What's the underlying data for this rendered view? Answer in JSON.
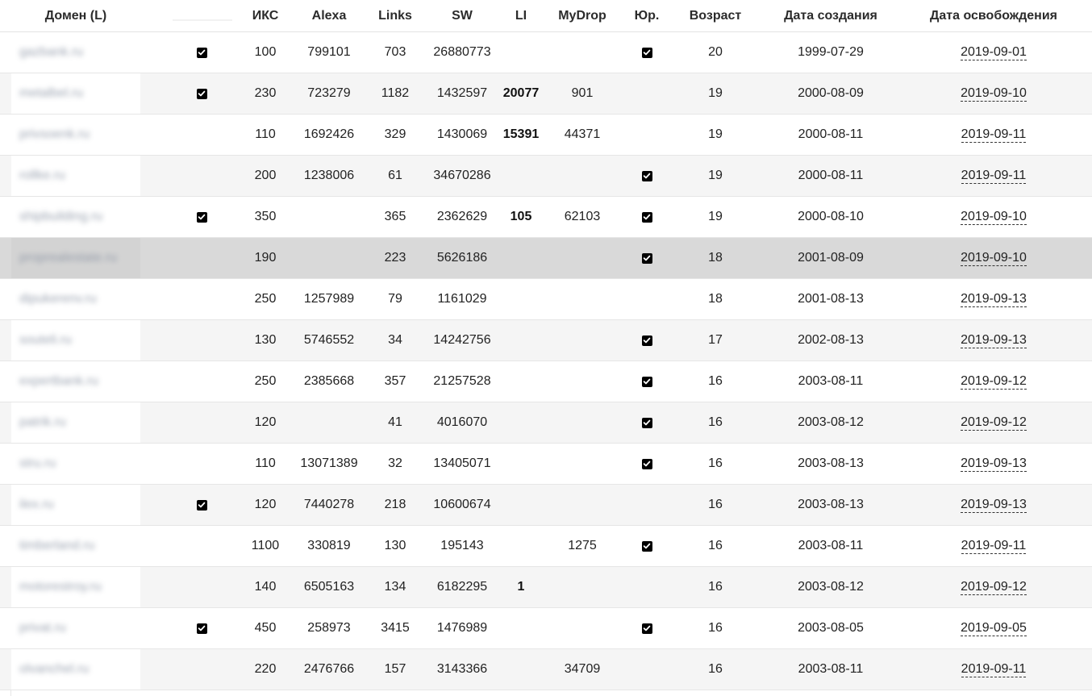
{
  "table": {
    "headers": {
      "domain": "Домен (L)",
      "blank": "",
      "iks": "ИКС",
      "alexa": "Alexa",
      "links": "Links",
      "sw": "SW",
      "li": "LI",
      "mydrop": "MyDrop",
      "yur": "Юр.",
      "age": "Возраст",
      "created": "Дата создания",
      "freed": "Дата освобождения"
    },
    "selected_row_index": 5,
    "rows": [
      {
        "domain": "gazbank.ru",
        "checked": true,
        "iks": "100",
        "alexa": "799101",
        "links": "703",
        "sw": "26880773",
        "li": "",
        "mydrop": "",
        "yur": true,
        "age": "20",
        "created": "1999-07-29",
        "freed": "2019-09-01"
      },
      {
        "domain": "metalbel.ru",
        "checked": true,
        "iks": "230",
        "alexa": "723279",
        "links": "1182",
        "sw": "1432597",
        "li": "20077",
        "mydrop": "901",
        "yur": false,
        "age": "19",
        "created": "2000-08-09",
        "freed": "2019-09-10"
      },
      {
        "domain": "privsoenk.ru",
        "checked": false,
        "iks": "110",
        "alexa": "1692426",
        "links": "329",
        "sw": "1430069",
        "li": "15391",
        "mydrop": "44371",
        "yur": false,
        "age": "19",
        "created": "2000-08-11",
        "freed": "2019-09-11"
      },
      {
        "domain": "rollke.ru",
        "checked": false,
        "iks": "200",
        "alexa": "1238006",
        "links": "61",
        "sw": "34670286",
        "li": "",
        "mydrop": "",
        "yur": true,
        "age": "19",
        "created": "2000-08-11",
        "freed": "2019-09-11"
      },
      {
        "domain": "shipbuilding.ru",
        "checked": true,
        "iks": "350",
        "alexa": "",
        "links": "365",
        "sw": "2362629",
        "li": "105",
        "mydrop": "62103",
        "yur": true,
        "age": "19",
        "created": "2000-08-10",
        "freed": "2019-09-10"
      },
      {
        "domain": "proprealestate.ru",
        "checked": false,
        "iks": "190",
        "alexa": "",
        "links": "223",
        "sw": "5626186",
        "li": "",
        "mydrop": "",
        "yur": true,
        "age": "18",
        "created": "2001-08-09",
        "freed": "2019-09-10"
      },
      {
        "domain": "dipukerenv.ru",
        "checked": false,
        "iks": "250",
        "alexa": "1257989",
        "links": "79",
        "sw": "1161029",
        "li": "",
        "mydrop": "",
        "yur": false,
        "age": "18",
        "created": "2001-08-13",
        "freed": "2019-09-13"
      },
      {
        "domain": "souteli.ru",
        "checked": false,
        "iks": "130",
        "alexa": "5746552",
        "links": "34",
        "sw": "14242756",
        "li": "",
        "mydrop": "",
        "yur": true,
        "age": "17",
        "created": "2002-08-13",
        "freed": "2019-09-13"
      },
      {
        "domain": "expertbank.ru",
        "checked": false,
        "iks": "250",
        "alexa": "2385668",
        "links": "357",
        "sw": "21257528",
        "li": "",
        "mydrop": "",
        "yur": true,
        "age": "16",
        "created": "2003-08-11",
        "freed": "2019-09-12"
      },
      {
        "domain": "patrik.ru",
        "checked": false,
        "iks": "120",
        "alexa": "",
        "links": "41",
        "sw": "4016070",
        "li": "",
        "mydrop": "",
        "yur": true,
        "age": "16",
        "created": "2003-08-12",
        "freed": "2019-09-12"
      },
      {
        "domain": "stru.ru",
        "checked": false,
        "iks": "110",
        "alexa": "13071389",
        "links": "32",
        "sw": "13405071",
        "li": "",
        "mydrop": "",
        "yur": true,
        "age": "16",
        "created": "2003-08-13",
        "freed": "2019-09-13"
      },
      {
        "domain": "ilex.ru",
        "checked": true,
        "iks": "120",
        "alexa": "7440278",
        "links": "218",
        "sw": "10600674",
        "li": "",
        "mydrop": "",
        "yur": false,
        "age": "16",
        "created": "2003-08-13",
        "freed": "2019-09-13"
      },
      {
        "domain": "timberland.ru",
        "checked": false,
        "iks": "1100",
        "alexa": "330819",
        "links": "130",
        "sw": "195143",
        "li": "",
        "mydrop": "1275",
        "yur": true,
        "age": "16",
        "created": "2003-08-11",
        "freed": "2019-09-11"
      },
      {
        "domain": "motorestroy.ru",
        "checked": false,
        "iks": "140",
        "alexa": "6505163",
        "links": "134",
        "sw": "6182295",
        "li": "1",
        "mydrop": "",
        "yur": false,
        "age": "16",
        "created": "2003-08-12",
        "freed": "2019-09-12"
      },
      {
        "domain": "privat.ru",
        "checked": true,
        "iks": "450",
        "alexa": "258973",
        "links": "3415",
        "sw": "1476989",
        "li": "",
        "mydrop": "",
        "yur": true,
        "age": "16",
        "created": "2003-08-05",
        "freed": "2019-09-05"
      },
      {
        "domain": "olvanchel.ru",
        "checked": false,
        "iks": "220",
        "alexa": "2476766",
        "links": "157",
        "sw": "3143366",
        "li": "",
        "mydrop": "34709",
        "yur": false,
        "age": "16",
        "created": "2003-08-11",
        "freed": "2019-09-11"
      }
    ]
  }
}
